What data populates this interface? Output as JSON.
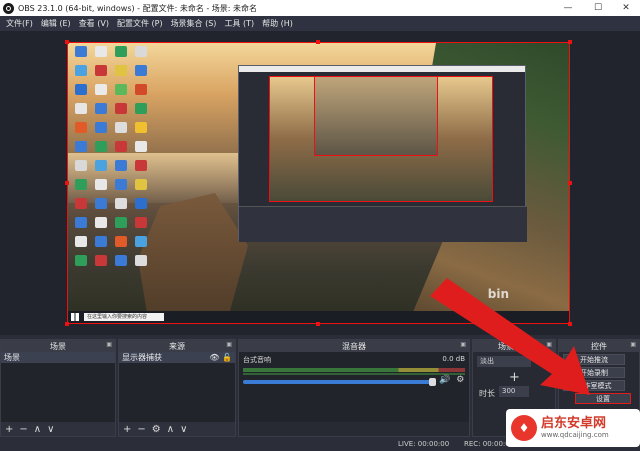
{
  "window": {
    "title": "OBS 23.1.0 (64-bit, windows) - 配置文件: 未命名 - 场景: 未命名",
    "min_glyph": "—",
    "max_glyph": "☐",
    "close_glyph": "✕"
  },
  "menu": [
    "文件(F)",
    "编辑 (E)",
    "查看 (V)",
    "配置文件 (P)",
    "场景集合 (S)",
    "工具 (T)",
    "帮助 (H)"
  ],
  "preview": {
    "taskbar_search": "在这里输入你要搜索的内容",
    "watermark": "bin"
  },
  "docks": {
    "scenes": {
      "title": "场景",
      "items": [
        "场景"
      ],
      "footer": [
        "+",
        "−",
        "∧",
        "∨"
      ]
    },
    "sources": {
      "title": "来源",
      "items": [
        "显示器捕获"
      ],
      "footer": [
        "+",
        "−",
        "⚙",
        "∧",
        "∨"
      ]
    },
    "mixer": {
      "title": "混音器",
      "track_name": "台式音响",
      "level": "0.0 dB"
    },
    "transitions": {
      "title": "场景过渡",
      "selected": "淡出",
      "duration_label": "时长",
      "duration_value": "300"
    },
    "controls": {
      "title": "控件",
      "buttons": [
        "开始推流",
        "开始录制",
        "工作室模式",
        "设置"
      ]
    }
  },
  "statusbar": {
    "live": "LIVE: 00:00:00",
    "rec": "REC: 00:00:00"
  },
  "brand": {
    "name": "启东安卓网",
    "url": "www.qdcaijing.com"
  },
  "colors": {
    "accent_red": "#e01d1d",
    "dock_bg": "#272a33"
  }
}
